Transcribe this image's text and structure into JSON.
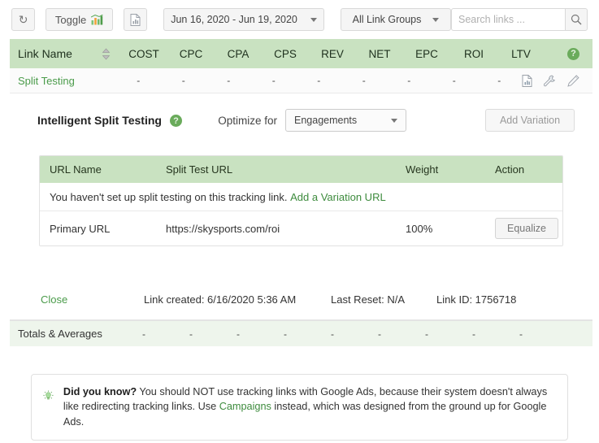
{
  "toolbar": {
    "refresh_icon": "refresh-icon",
    "toggle_label": "Toggle",
    "toggle_icon": "bar-chart-icon",
    "export_icon": "document-export-icon",
    "date_range": "Jun 16, 2020 - Jun 19, 2020",
    "link_group": "All Link Groups",
    "search_placeholder": "Search links ...",
    "search_value": "",
    "search_icon": "search-icon"
  },
  "table": {
    "columns": [
      "Link Name",
      "COST",
      "CPC",
      "CPA",
      "CPS",
      "REV",
      "NET",
      "EPC",
      "ROI",
      "LTV"
    ],
    "sort_icon": "sort-updown-icon",
    "header_help_icon": "help-circle-icon",
    "row": {
      "name": "Split Testing",
      "values": [
        "-",
        "-",
        "-",
        "-",
        "-",
        "-",
        "-",
        "-",
        "-"
      ],
      "actions": [
        "report-icon",
        "wrench-icon",
        "pencil-icon"
      ]
    },
    "totals": {
      "label": "Totals & Averages",
      "values": [
        "-",
        "-",
        "-",
        "-",
        "-",
        "-",
        "-",
        "-",
        "-"
      ]
    }
  },
  "panel": {
    "title": "Intelligent Split Testing",
    "title_help_icon": "help-circle-icon",
    "optimize_label": "Optimize for",
    "optimize_value": "Engagements",
    "optimize_options": [
      "Engagements"
    ],
    "add_variation_label": "Add Variation",
    "inner_table": {
      "columns": [
        "URL Name",
        "Split Test URL",
        "Weight",
        "Action"
      ],
      "empty_notice": "You haven't set up split testing on this tracking link.",
      "empty_notice_link": "Add a Variation URL",
      "rows": [
        {
          "url_name": "Primary URL",
          "url": "https://skysports.com/roi",
          "weight": "100%",
          "action_label": "Equalize"
        }
      ]
    },
    "footer": {
      "close_label": "Close",
      "link_created": "Link created: 6/16/2020 5:36 AM",
      "last_reset": "Last Reset: N/A",
      "link_id": "Link ID: 1756718"
    }
  },
  "notice": {
    "icon": "lightbulb-icon",
    "bold_lead": "Did you know?",
    "text_1": " You should NOT use tracking links with Google Ads, because their system doesn't always like redirecting tracking links. Use ",
    "link_text": "Campaigns",
    "text_2": " instead, which was designed from the ground up for Google Ads."
  },
  "colors": {
    "header_green": "#c9e2c1",
    "accent_green": "#4a9b4a",
    "totals_green": "#eef5ec"
  }
}
